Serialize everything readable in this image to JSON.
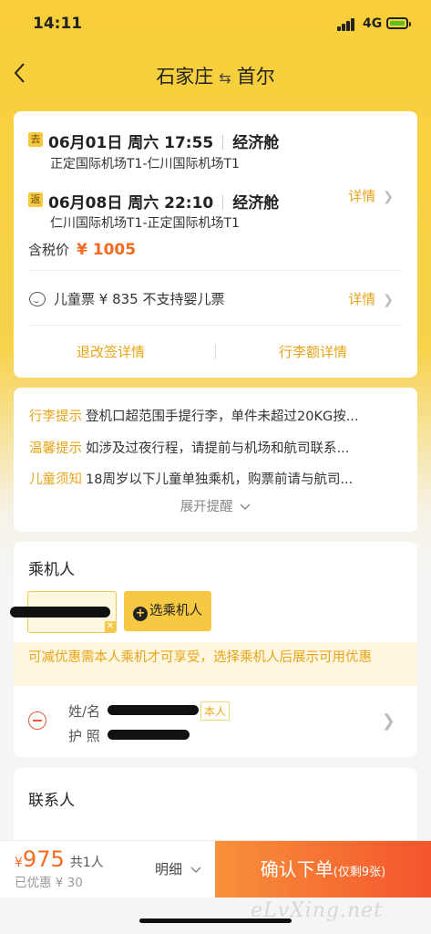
{
  "status_bar": {
    "time": "14:11",
    "network": "4G"
  },
  "nav": {
    "origin": "石家庄",
    "arrow": "⇆",
    "destination": "首尔"
  },
  "flight": {
    "outbound": {
      "tag": "去",
      "datetime": "06月01日 周六 17:55",
      "cabin": "经济舱",
      "route": "正定国际机场T1-仁川国际机场T1"
    },
    "inbound": {
      "tag": "返",
      "datetime": "06月08日 周六 22:10",
      "cabin": "经济舱",
      "route": "仁川国际机场T1-正定国际机场T1"
    },
    "details_label": "详情",
    "price_label": "含税价",
    "price": "¥ 1005",
    "child_info": "儿童票 ¥ 835  不支持婴儿票",
    "child_details_label": "详情",
    "refund_link": "退改签详情",
    "baggage_link": "行李额详情"
  },
  "tips": {
    "items": [
      {
        "title": "行李提示",
        "text": "登机口超范围手提行李，单件未超过20KG按..."
      },
      {
        "title": "温馨提示",
        "text": "如涉及过夜行程，请提前与机场和航司联系..."
      },
      {
        "title": "儿童须知",
        "text": "18周岁以下儿童单独乘机，购票前请与航司..."
      }
    ],
    "expand_label": "展开提醒"
  },
  "passengers": {
    "title": "乘机人",
    "select_label": "选乘机人",
    "notice": "可减优惠需本人乘机才可享受，选择乘机人后展示可用优惠",
    "name_label": "姓/名",
    "self_tag": "本人",
    "id_label": "护 照"
  },
  "contact": {
    "title": "联系人"
  },
  "bottom_bar": {
    "currency": "¥",
    "total": "975",
    "count": "共1人",
    "saved": "已优惠 ¥ 30",
    "breakdown_label": "明细",
    "confirm_label": "确认下单",
    "remaining": "(仅剩9张)"
  },
  "watermark": "eLvXing.net",
  "colors": {
    "accent": "#f7c842",
    "highlight": "#e8a418",
    "price": "#f56a22"
  }
}
